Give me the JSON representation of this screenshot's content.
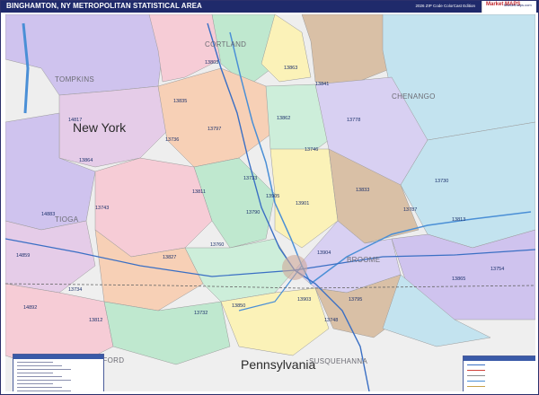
{
  "title": "BINGHAMTON, NY METROPOLITAN STATISTICAL AREA",
  "edition": "2026 ZIP Code ColorCast Edition",
  "logo": {
    "brand": "Market MAPS",
    "sub": "Marketmaps.com"
  },
  "colors": {
    "header": "#1f2a6b",
    "zone_palette": [
      "#cfc3ee",
      "#f6ccd6",
      "#bfe8cf",
      "#fbf2b8",
      "#d9c0a6",
      "#c3e3ef",
      "#e5cce8",
      "#f7d0b6",
      "#cdeeda",
      "#d8d0f2"
    ],
    "water": "#4a8fd6",
    "interstate": "#3a6fc4",
    "highway": "#d0423b"
  },
  "states": [
    {
      "name": "New York"
    },
    {
      "name": "Pennsylvania"
    }
  ],
  "counties": [
    "CORTLAND",
    "TOMPKINS",
    "CHENANGO",
    "TIOGA",
    "BROOME",
    "BRADFORD",
    "SUSQUEHANNA"
  ],
  "zips": [
    "13803",
    "13863",
    "13841",
    "13835",
    "13797",
    "13862",
    "13778",
    "14817",
    "13736",
    "13746",
    "13864",
    "13811",
    "13733",
    "13833",
    "13730",
    "13743",
    "13901",
    "13905",
    "13787",
    "14883",
    "13790",
    "13813",
    "13760",
    "13827",
    "13904",
    "14859",
    "13734",
    "13754",
    "13865",
    "14892",
    "13903",
    "13795",
    "13732",
    "13850",
    "13748",
    "13812"
  ],
  "legend": {
    "icon": "compass-rose"
  }
}
